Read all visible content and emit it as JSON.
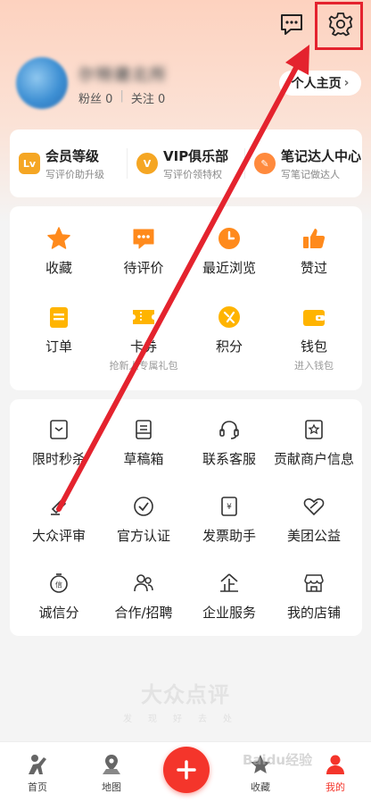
{
  "header": {
    "username": "尔特建北所",
    "fans_label": "粉丝",
    "fans_count": "0",
    "follow_label": "关注",
    "follow_count": "0",
    "profile_button": "个人主页",
    "profile_chevron": "›"
  },
  "top_icons": {
    "message": "message-icon",
    "settings": "gear-icon"
  },
  "membership": [
    {
      "badge": "Lv",
      "title": "会员等级",
      "subtitle": "写评价助升级",
      "color": "#f5a623"
    },
    {
      "badge": "V",
      "title": "VIP俱乐部",
      "subtitle": "写评价领特权",
      "color": "#f5a623"
    },
    {
      "badge": "✎",
      "title": "笔记达人中心",
      "subtitle": "写笔记做达人",
      "color": "#ff8a3d"
    }
  ],
  "grid1": [
    {
      "label": "收藏",
      "icon": "star-icon"
    },
    {
      "label": "待评价",
      "icon": "comment-icon"
    },
    {
      "label": "最近浏览",
      "icon": "clock-icon"
    },
    {
      "label": "赞过",
      "icon": "thumbs-up-icon"
    },
    {
      "label": "订单",
      "icon": "order-icon"
    },
    {
      "label": "卡券",
      "icon": "ticket-icon",
      "sub": "抢新人专属礼包"
    },
    {
      "label": "积分",
      "icon": "points-icon"
    },
    {
      "label": "钱包",
      "icon": "wallet-icon",
      "sub": "进入钱包"
    }
  ],
  "grid2": [
    {
      "label": "限时秒杀",
      "icon": "flash-sale-icon"
    },
    {
      "label": "草稿箱",
      "icon": "draft-box-icon"
    },
    {
      "label": "联系客服",
      "icon": "headset-icon"
    },
    {
      "label": "贡献商户信息",
      "icon": "shop-info-icon"
    },
    {
      "label": "大众评审",
      "icon": "gavel-icon"
    },
    {
      "label": "官方认证",
      "icon": "check-circle-icon"
    },
    {
      "label": "发票助手",
      "icon": "invoice-icon"
    },
    {
      "label": "美团公益",
      "icon": "charity-heart-icon"
    },
    {
      "label": "诚信分",
      "icon": "credit-icon"
    },
    {
      "label": "合作/招聘",
      "icon": "people-icon"
    },
    {
      "label": "企业服务",
      "icon": "enterprise-icon"
    },
    {
      "label": "我的店铺",
      "icon": "store-icon"
    }
  ],
  "footer": {
    "logo": "大众点评",
    "slogan": "发现好去处"
  },
  "tabbar": [
    {
      "label": "首页",
      "icon": "home-icon"
    },
    {
      "label": "地图",
      "icon": "map-icon"
    },
    {
      "label": "收藏",
      "icon": "favorite-icon"
    },
    {
      "label": "我的",
      "icon": "profile-icon"
    }
  ],
  "watermark": "Baidu经验",
  "colors": {
    "accent": "#f4352b",
    "orange": "#ff8a1c",
    "annotation": "#e4232e"
  }
}
